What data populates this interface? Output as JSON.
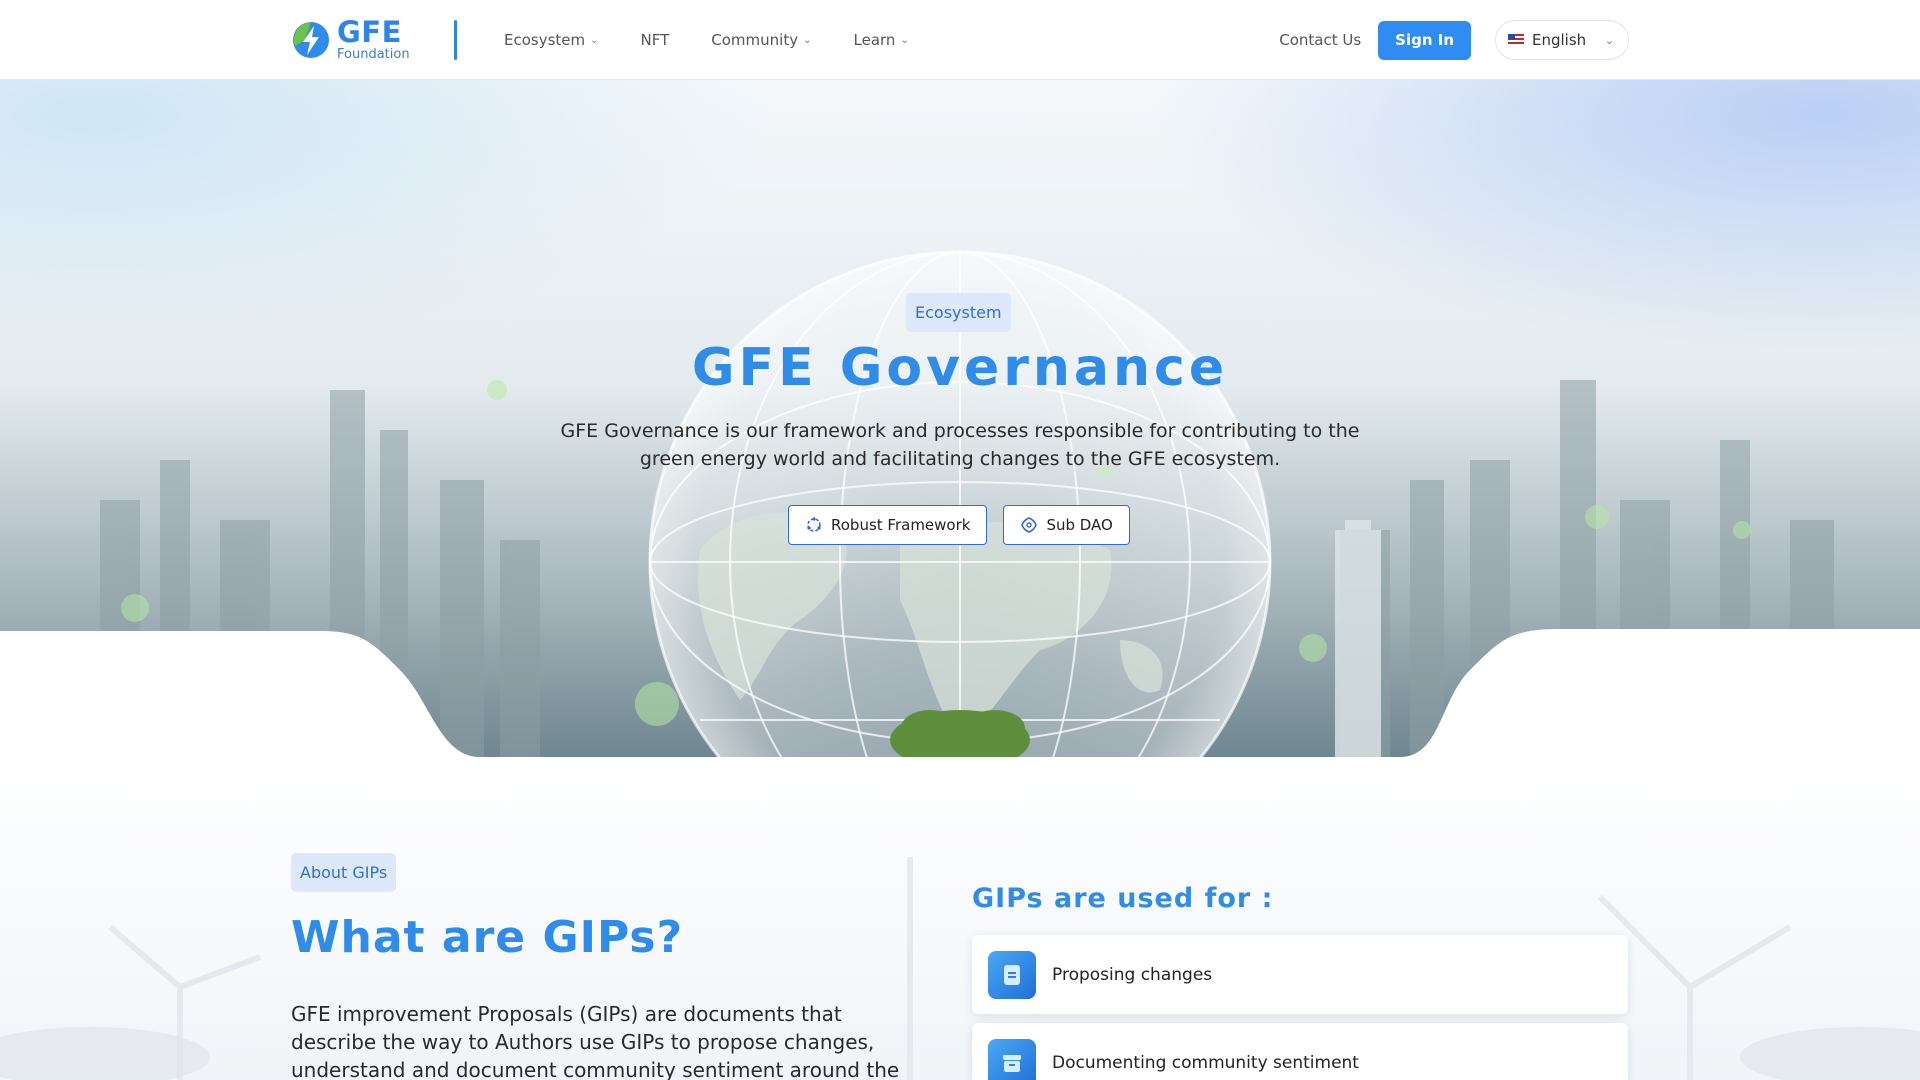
{
  "header": {
    "logo_name": "GFE",
    "logo_sub": "Foundation",
    "nav": [
      {
        "label": "Ecosystem",
        "has_dropdown": true
      },
      {
        "label": "NFT",
        "has_dropdown": false
      },
      {
        "label": "Community",
        "has_dropdown": true
      },
      {
        "label": "Learn",
        "has_dropdown": true
      }
    ],
    "contact_label": "Contact Us",
    "signin_label": "Sign In",
    "language": "English"
  },
  "hero": {
    "badge": "Ecosystem",
    "title": "GFE Governance",
    "description": "GFE Governance is our framework and processes responsible for contributing to the green energy world and facilitating changes to the GFE ecosystem.",
    "buttons": [
      {
        "label": "Robust Framework",
        "icon": "framework-icon"
      },
      {
        "label": "Sub DAO",
        "icon": "dao-icon"
      }
    ]
  },
  "about": {
    "badge": "About GIPs",
    "title": "What are GIPs?",
    "text": "GFE improvement Proposals (GIPs) are documents that describe the way to Authors use GIPs to propose changes, understand and document community sentiment around the",
    "uses_title": "GIPs are used for :",
    "uses": [
      {
        "label": "Proposing changes",
        "icon": "document-icon"
      },
      {
        "label": "Documenting community sentiment",
        "icon": "archive-icon"
      }
    ]
  },
  "colors": {
    "accent": "#2f8ce8",
    "button_blue": "#2f8cf0",
    "badge_bg": "#dde9fb"
  }
}
